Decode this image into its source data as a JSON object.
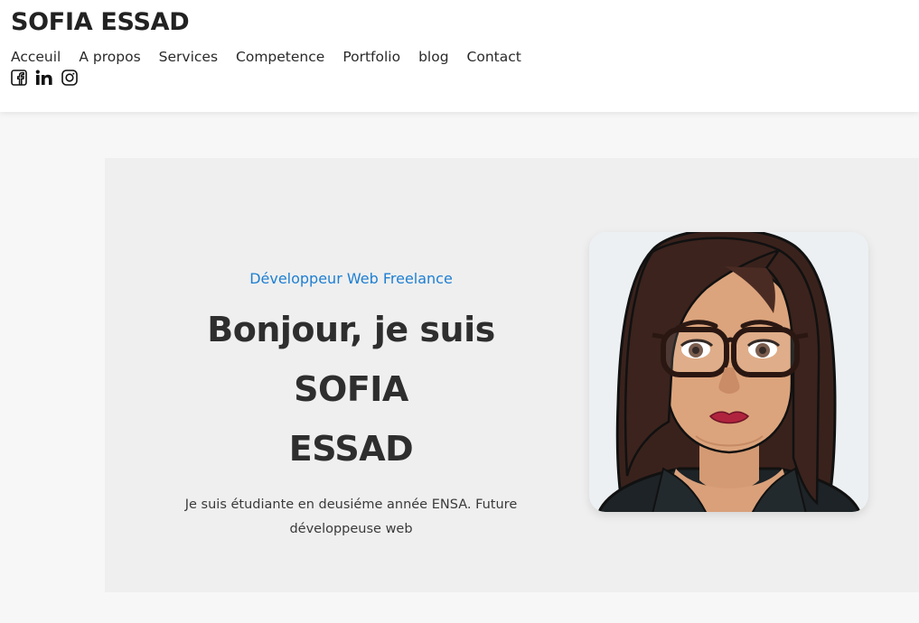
{
  "header": {
    "brand": "SOFIA ESSAD",
    "nav": [
      "Acceuil",
      "A propos",
      "Services",
      "Competence",
      "Portfolio",
      "blog",
      "Contact"
    ],
    "socials": [
      "facebook-icon",
      "linkedin-icon",
      "instagram-icon"
    ]
  },
  "hero": {
    "role": "Développeur Web Freelance",
    "headline_line1": "Bonjour, je suis SOFIA",
    "headline_line2": "ESSAD",
    "description_line1": "Je suis étudiante en deusiéme année ENSA. Future",
    "description_line2": "développeuse web"
  },
  "colors": {
    "accent": "#1e7fd2",
    "hero_bg": "#efefef",
    "page_bg": "#f7f7f7"
  }
}
